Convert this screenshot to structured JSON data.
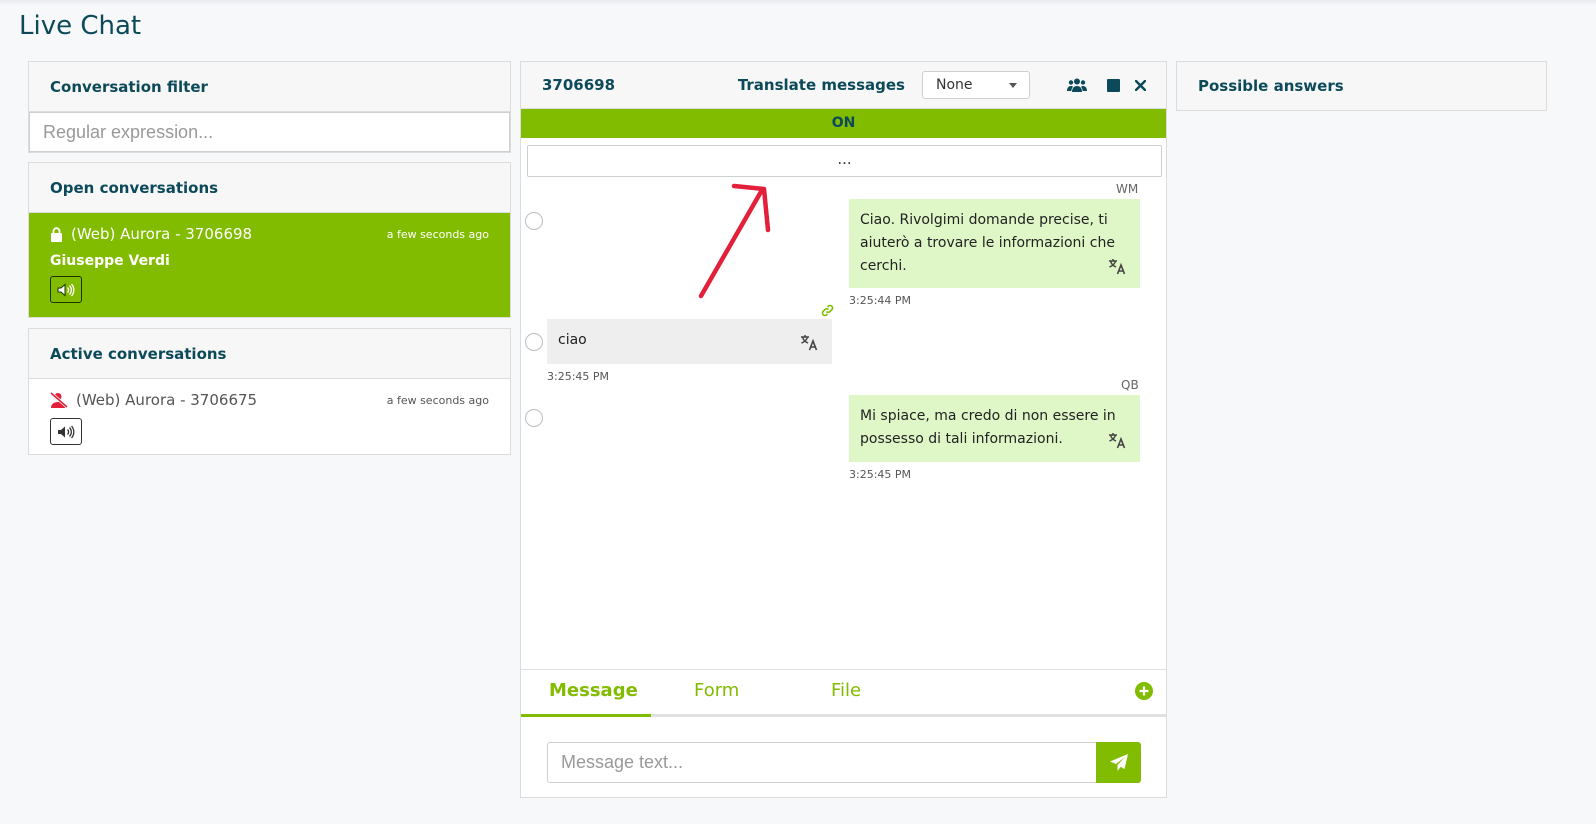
{
  "app": {
    "title": "Live Chat"
  },
  "filter": {
    "title": "Conversation filter",
    "placeholder": "Regular expression..."
  },
  "open_conversations": {
    "title": "Open conversations",
    "items": [
      {
        "name": "(Web) Aurora  - 3706698",
        "time": "a few seconds ago",
        "user": "Giuseppe Verdi",
        "icon": "lock-icon"
      }
    ]
  },
  "active_conversations": {
    "title": "Active conversations",
    "items": [
      {
        "name": "(Web) Aurora  - 3706675",
        "time": "a few seconds ago",
        "icon": "user-slash-icon"
      }
    ]
  },
  "chat": {
    "id": "3706698",
    "translate_label": "Translate messages",
    "translate_value": "None",
    "status": "ON",
    "load_more": "...",
    "messages": [
      {
        "sender": "WM",
        "text": "Ciao. Rivolgimi domande precise, ti aiuterò a trovare le informazioni che cerchi.",
        "time": "3:25:44 PM",
        "direction": "out"
      },
      {
        "sender": "",
        "text": "ciao",
        "time": "3:25:45 PM",
        "direction": "in"
      },
      {
        "sender": "QB",
        "text": "Mi spiace, ma credo di non essere in possesso di tali informazioni.",
        "time": "3:25:45 PM",
        "direction": "out"
      }
    ],
    "tabs": [
      {
        "label": "Message"
      },
      {
        "label": "Form"
      },
      {
        "label": "File"
      }
    ],
    "input_placeholder": "Message text..."
  },
  "answers": {
    "title": "Possible answers"
  },
  "colors": {
    "accent": "#82bc00",
    "heading": "#0c4a5a",
    "bubble_out": "#dff7c7",
    "bubble_in": "#eeeeee",
    "annotation": "#e3203a"
  }
}
